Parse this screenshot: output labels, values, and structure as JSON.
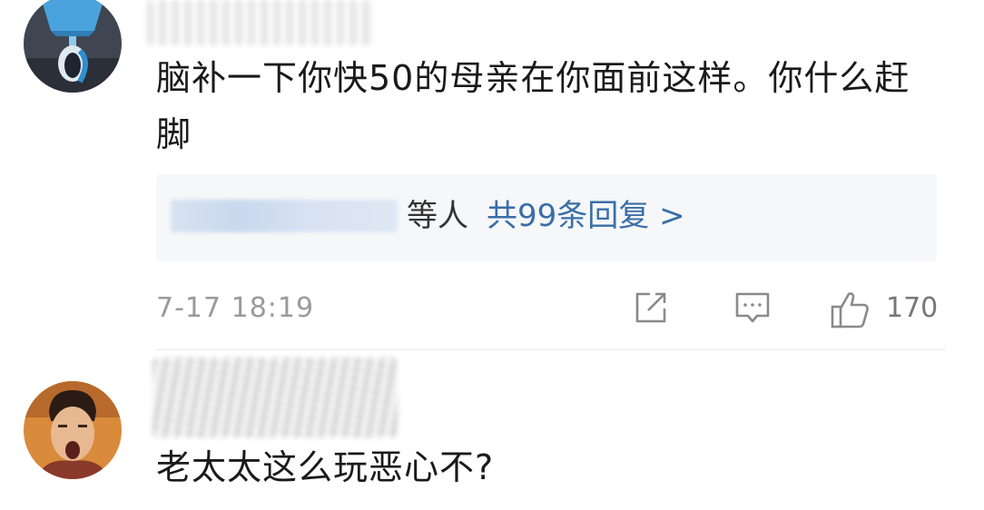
{
  "comments": [
    {
      "text": "脑补一下你快50的母亲在你面前这样。你什么赶脚",
      "replies": {
        "suffix": "等人",
        "count_label": "共99条回复 >"
      },
      "timestamp": "7-17 18:19",
      "actions": {
        "share_icon": "share-icon",
        "comment_icon": "comment-icon",
        "like_icon": "thumbs-up-icon",
        "like_count": "170"
      }
    },
    {
      "text": "老太太这么玩恶心不?"
    }
  ],
  "colors": {
    "text": "#1a1a1a",
    "link": "#3b6ea8",
    "meta": "#9a9a9a",
    "reply_bg": "#f6f7f9"
  }
}
